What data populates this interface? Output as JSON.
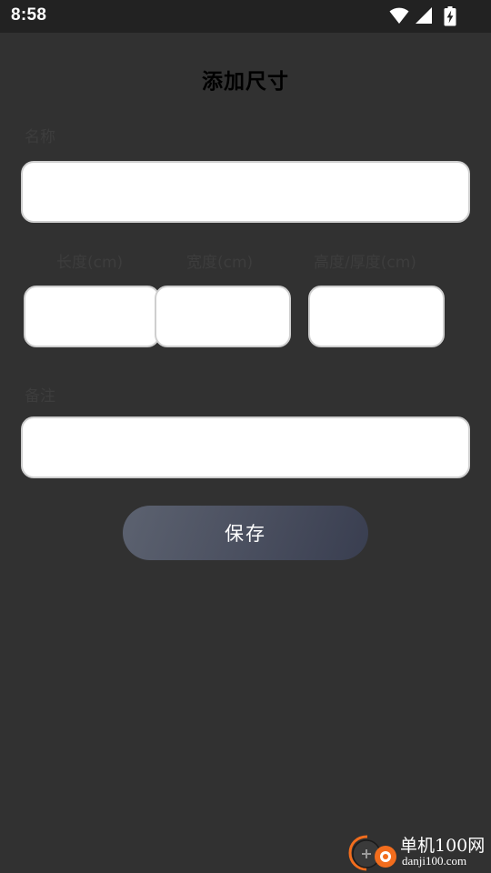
{
  "status_bar": {
    "time": "8:58",
    "icons": [
      "wifi-icon",
      "cell-signal-icon",
      "battery-charging-icon"
    ]
  },
  "page": {
    "title": "添加尺寸"
  },
  "form": {
    "name_label": "名称",
    "name_value": "",
    "dimension_labels": [
      "长度(cm)",
      "宽度(cm)",
      "高度/厚度(cm)"
    ],
    "dimension_values": [
      "",
      "",
      ""
    ],
    "note_label": "备注",
    "note_value": ""
  },
  "actions": {
    "save_label": "保存"
  },
  "watermark": {
    "name": "单机100网",
    "url": "danji100.com"
  },
  "colors": {
    "background": "#313131",
    "status_bar": "#222222",
    "field_fill": "#ffffff",
    "field_border": "#cfcfcf",
    "button_start": "#5c6270",
    "button_end": "#393e50",
    "watermark_accent": "#f26d1d"
  }
}
